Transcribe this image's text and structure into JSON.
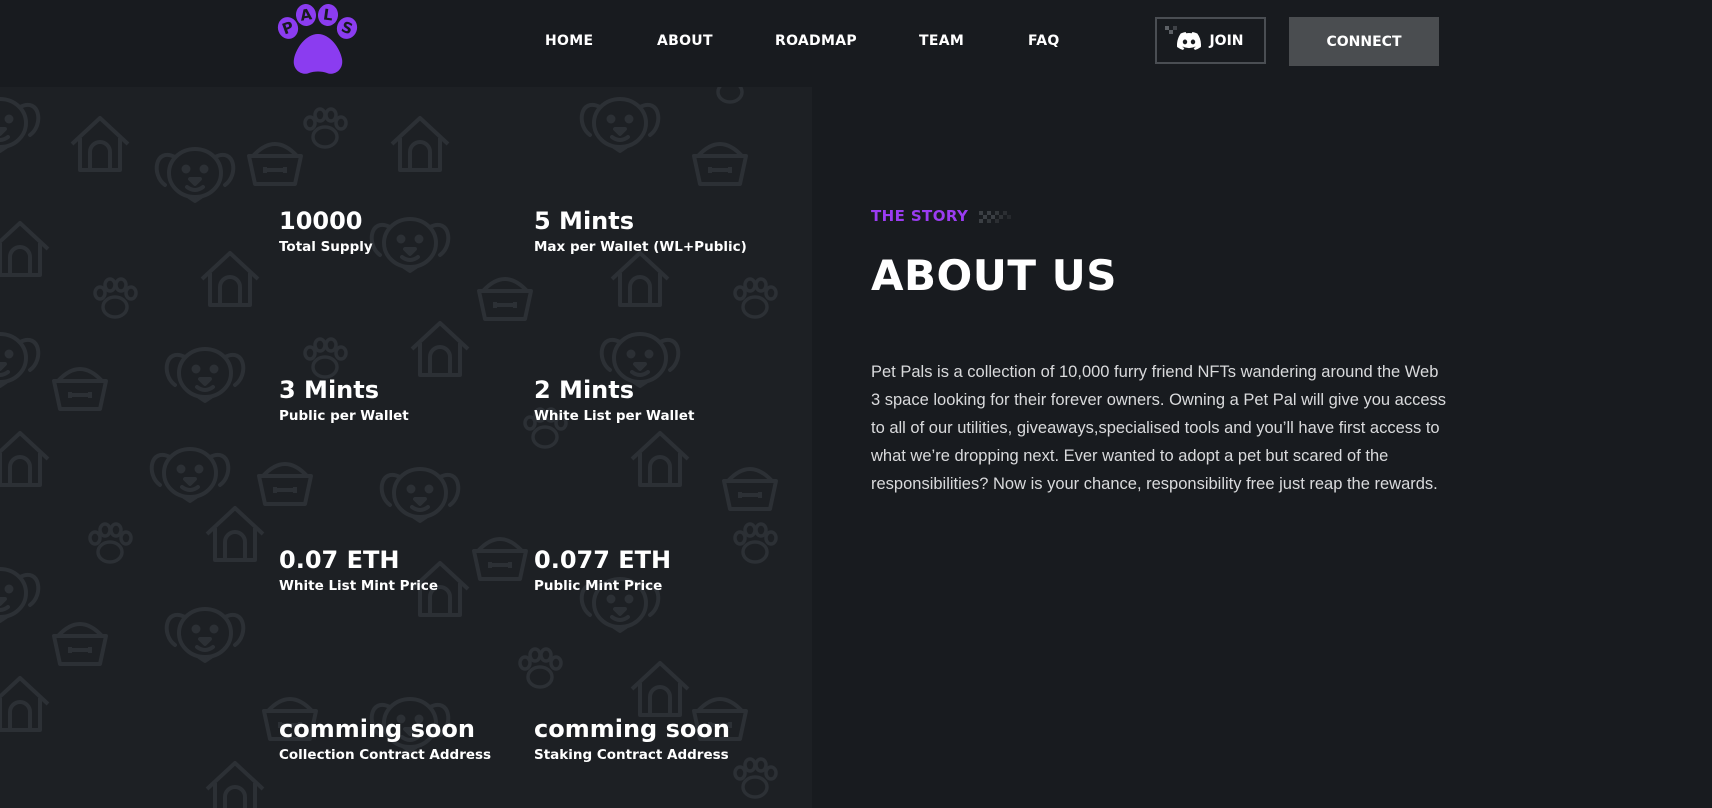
{
  "brand": {
    "logo_text": "PALS",
    "accent_color": "#8b3cf0"
  },
  "nav": {
    "links": [
      "HOME",
      "ABOUT",
      "ROADMAP",
      "TEAM",
      "FAQ"
    ],
    "join_label": "JOIN",
    "connect_label": "CONNECT"
  },
  "stats": [
    {
      "value": "10000",
      "label": "Total Supply"
    },
    {
      "value": "5 Mints",
      "label": "Max per Wallet (WL+Public)"
    },
    {
      "value": "3 Mints",
      "label": "Public per Wallet"
    },
    {
      "value": "2 Mints",
      "label": "White List per Wallet"
    },
    {
      "value": "0.07 ETH",
      "label": "White List Mint Price"
    },
    {
      "value": "0.077 ETH",
      "label": "Public Mint Price"
    },
    {
      "value": "comming soon",
      "label": "Collection Contract Address"
    },
    {
      "value": "comming soon",
      "label": "Staking Contract Address"
    }
  ],
  "about": {
    "eyebrow": "THE STORY",
    "title": "ABOUT US",
    "body": "Pet Pals is a collection of 10,000 furry friend NFTs wandering around the Web 3 space looking for their forever owners. Owning a Pet Pal will give you access to all of our utilities, giveaways,specialised tools and you’ll have first access to what we’re dropping next. Ever wanted to adopt a pet but scared of the responsibilities? Now is your chance, responsibility free just reap the rewards."
  },
  "colors": {
    "background": "#1a1d21",
    "header": "#181b1f",
    "stat_panel": "#1d2024",
    "accent": "#9b3cf2",
    "connect_button": "#4a4d50"
  },
  "icons": [
    "paw-logo-icon",
    "discord-icon",
    "dog-face-icon",
    "dog-house-icon",
    "paw-print-icon",
    "food-bowl-icon"
  ]
}
